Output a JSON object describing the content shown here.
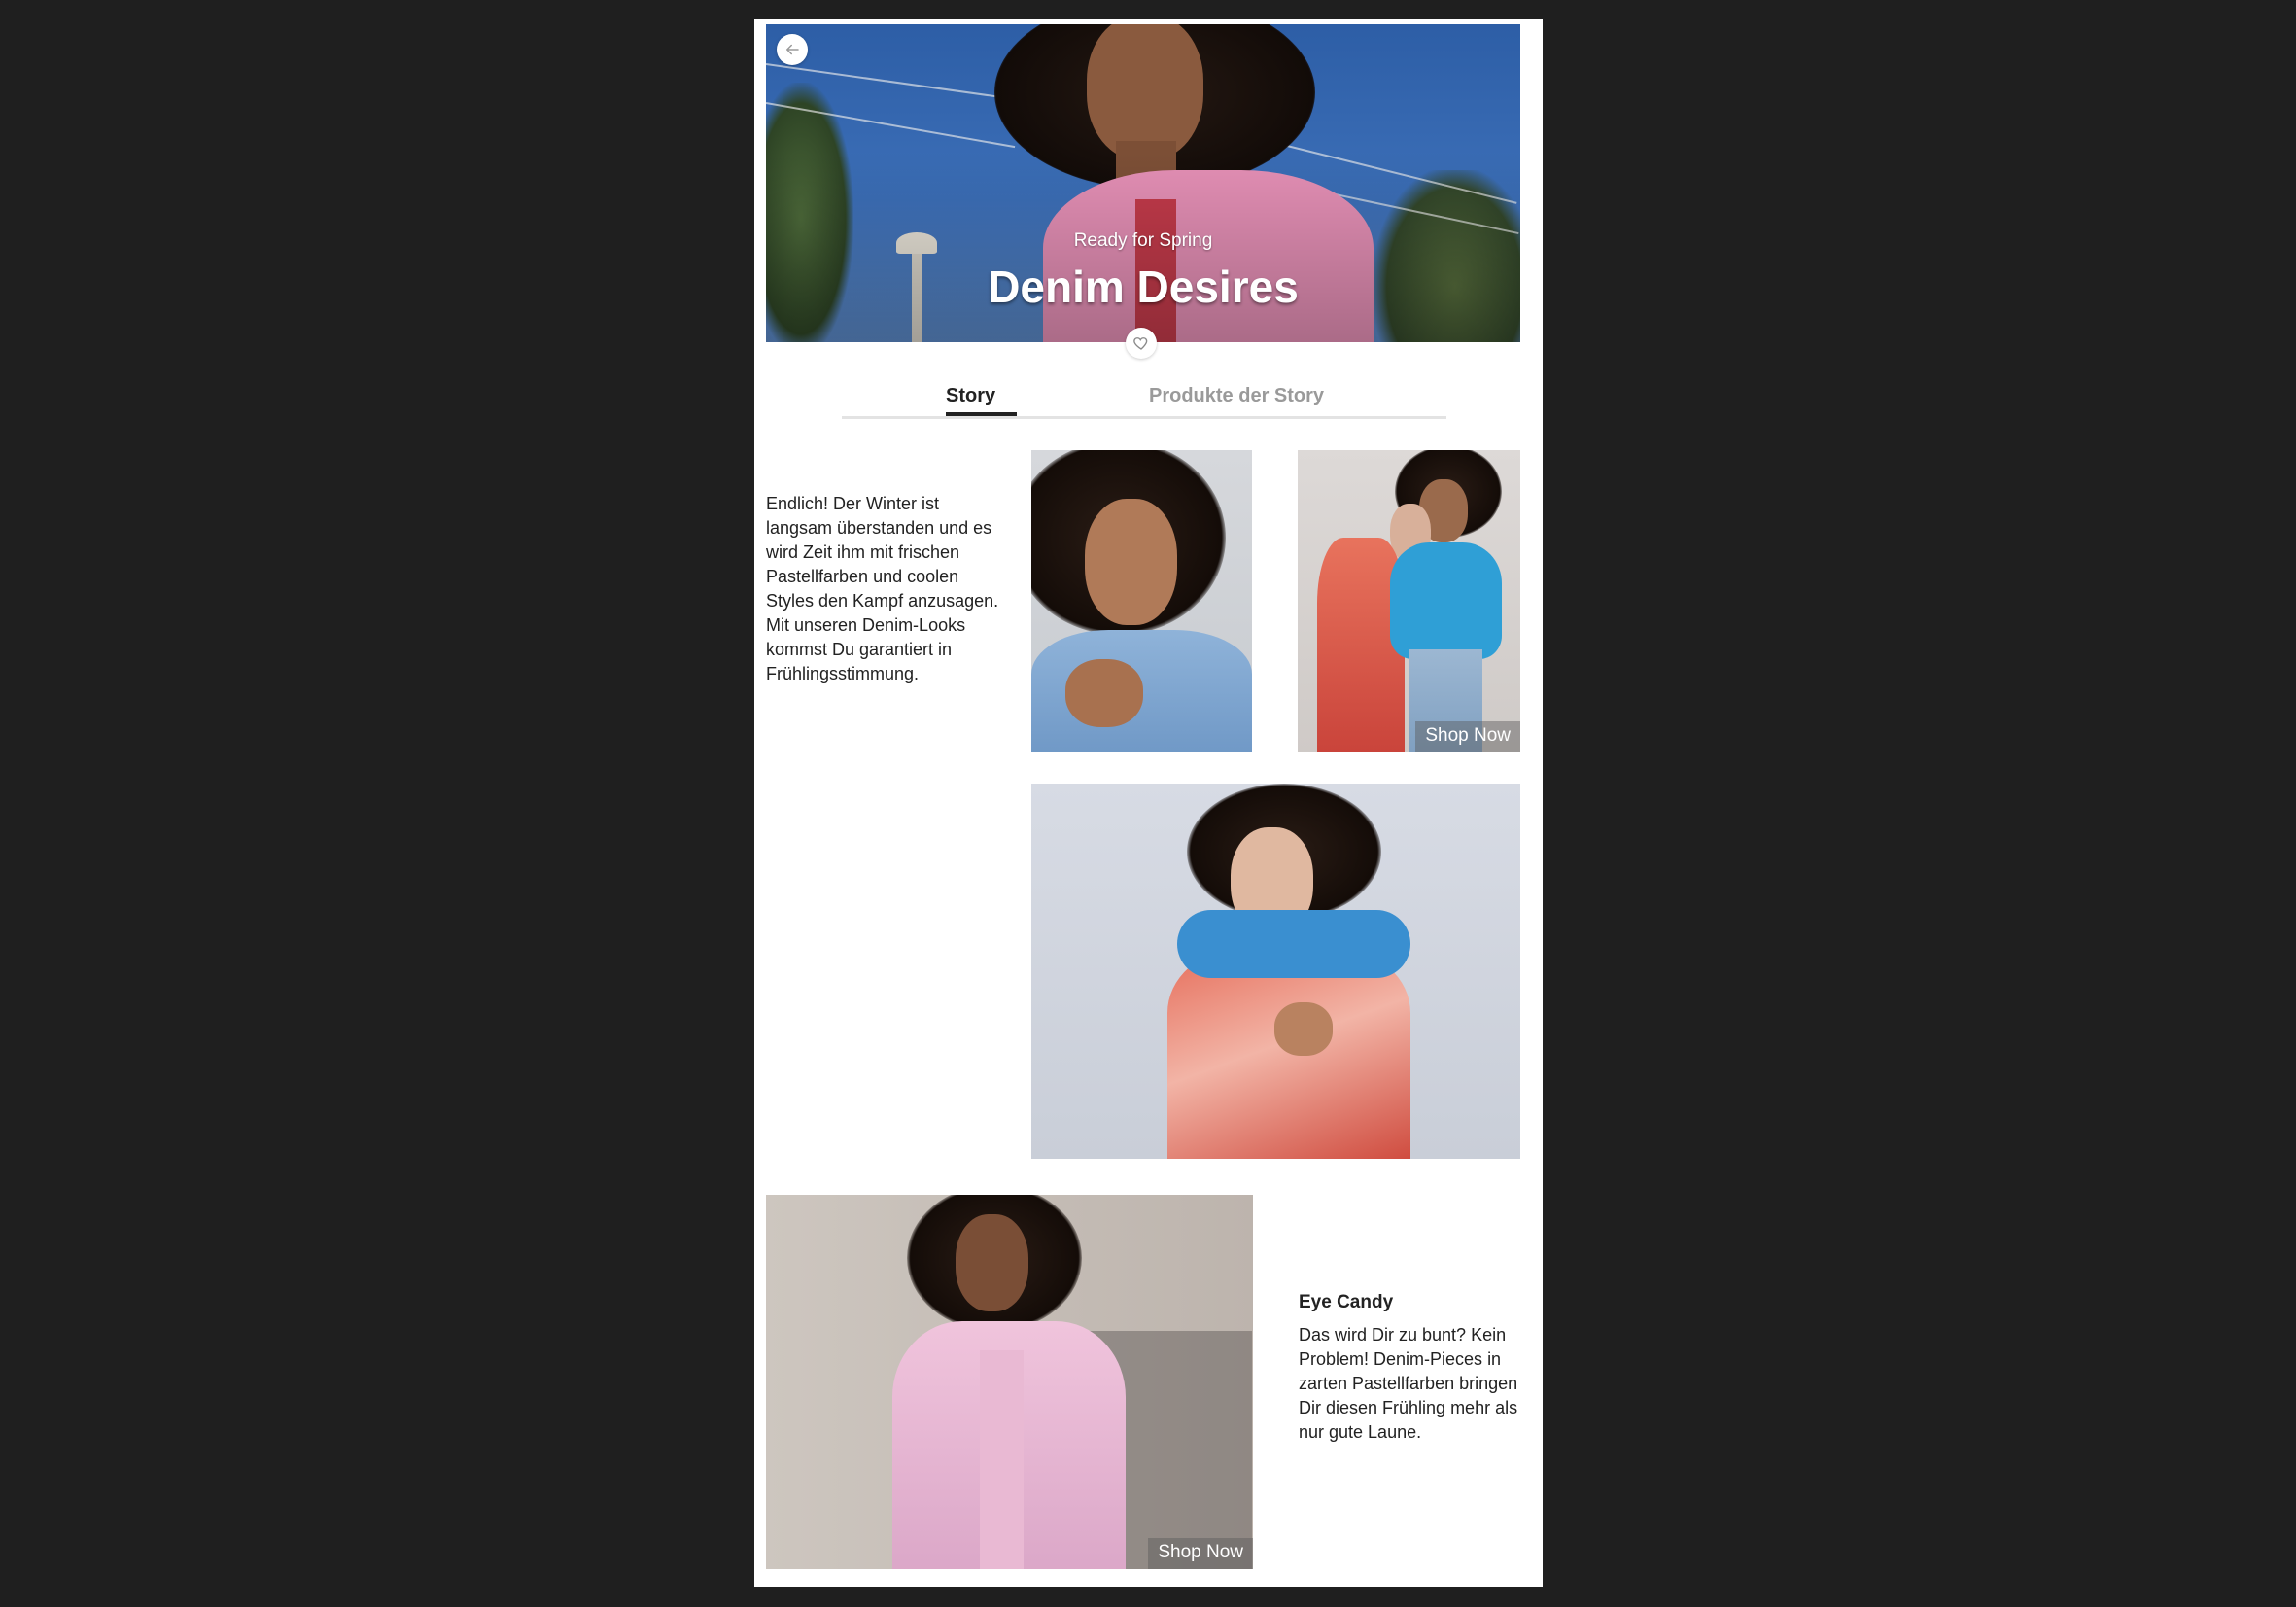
{
  "hero": {
    "subtitle": "Ready for Spring",
    "title": "Denim Desires"
  },
  "tabs": [
    {
      "label": "Story",
      "active": true
    },
    {
      "label": "Produkte der Story",
      "active": false
    }
  ],
  "intro": {
    "text": "Endlich! Der Winter ist langsam überstanden und es wird Zeit ihm mit frischen Pastellfarben und coolen Styles den Kampf anzusagen. Mit unseren Denim-Looks kommst Du garantiert in Frühlingsstimmung."
  },
  "photos": {
    "p2_cta": "Shop Now",
    "p4_cta": "Shop Now"
  },
  "eye_candy": {
    "title": "Eye Candy",
    "text": "Das wird Dir zu bunt? Kein Problem! Denim-Pieces in zarten Pastellfarben bringen Dir diesen Frühling mehr als nur gute Laune."
  },
  "colors": {
    "page_bg": "#1f1f1f",
    "card_bg": "#ffffff",
    "text": "#222222",
    "tab_inactive": "#9a9a9a"
  }
}
